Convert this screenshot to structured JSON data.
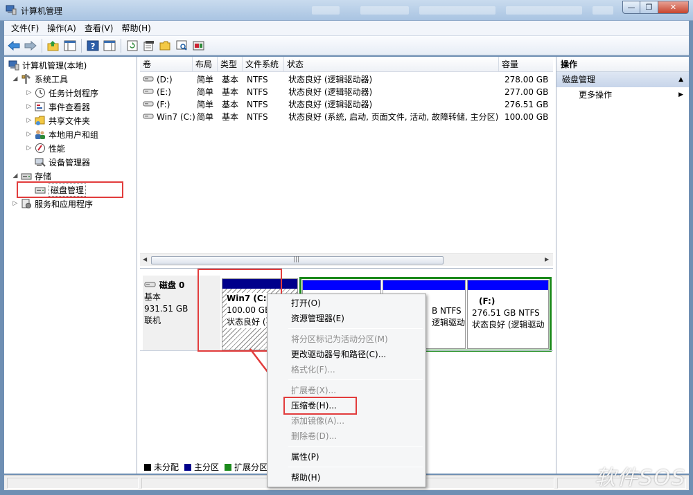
{
  "window": {
    "title": "计算机管理",
    "min": "—",
    "max": "❐",
    "close": "✕"
  },
  "menu": [
    "文件(F)",
    "操作(A)",
    "查看(V)",
    "帮助(H)"
  ],
  "tree": {
    "root": "计算机管理(本地)",
    "system_tools": "系统工具",
    "task_scheduler": "任务计划程序",
    "event_viewer": "事件查看器",
    "shared_folders": "共享文件夹",
    "local_users": "本地用户和组",
    "performance": "性能",
    "device_manager": "设备管理器",
    "storage": "存储",
    "disk_management": "磁盘管理",
    "services_apps": "服务和应用程序"
  },
  "columns": [
    "卷",
    "布局",
    "类型",
    "文件系统",
    "状态",
    "容量"
  ],
  "volumes": [
    {
      "name": "(D:)",
      "layout": "简单",
      "type": "基本",
      "fs": "NTFS",
      "status": "状态良好 (逻辑驱动器)",
      "capacity": "278.00 GB"
    },
    {
      "name": "(E:)",
      "layout": "简单",
      "type": "基本",
      "fs": "NTFS",
      "status": "状态良好 (逻辑驱动器)",
      "capacity": "277.00 GB"
    },
    {
      "name": "(F:)",
      "layout": "简单",
      "type": "基本",
      "fs": "NTFS",
      "status": "状态良好 (逻辑驱动器)",
      "capacity": "276.51 GB"
    },
    {
      "name": "Win7 (C:)",
      "layout": "简单",
      "type": "基本",
      "fs": "NTFS",
      "status": "状态良好 (系统, 启动, 页面文件, 活动, 故障转储, 主分区)",
      "capacity": "100.00 GB"
    }
  ],
  "scroll_grip": "|||",
  "disk": {
    "name": "磁盘 0",
    "type": "基本",
    "size": "931.51 GB",
    "state": "联机",
    "c_title": "Win7  (C:)",
    "c_size": "100.00 GB",
    "c_status": "状态良好 (",
    "mid_fs": "B NTFS",
    "mid_status": "逻辑驱动",
    "f_title": "(F:)",
    "f_size": "276.51 GB NTFS",
    "f_status": "状态良好 (逻辑驱动"
  },
  "legend": [
    "未分配",
    "主分区",
    "扩展分区"
  ],
  "actions": {
    "header": "操作",
    "section": "磁盘管理",
    "more": "更多操作"
  },
  "context_menu": {
    "open": "打开(O)",
    "explorer": "资源管理器(E)",
    "mark_active": "将分区标记为活动分区(M)",
    "change_letter": "更改驱动器号和路径(C)...",
    "format": "格式化(F)...",
    "extend": "扩展卷(X)...",
    "shrink": "压缩卷(H)...",
    "mirror": "添加镜像(A)...",
    "delete": "删除卷(D)...",
    "properties": "属性(P)",
    "help": "帮助(H)"
  },
  "watermark": "软件SOS",
  "colors": {
    "primary": "#00008b",
    "logical": "#0000ff",
    "extended": "#1b8a1b",
    "highlight": "#e23c3c"
  }
}
